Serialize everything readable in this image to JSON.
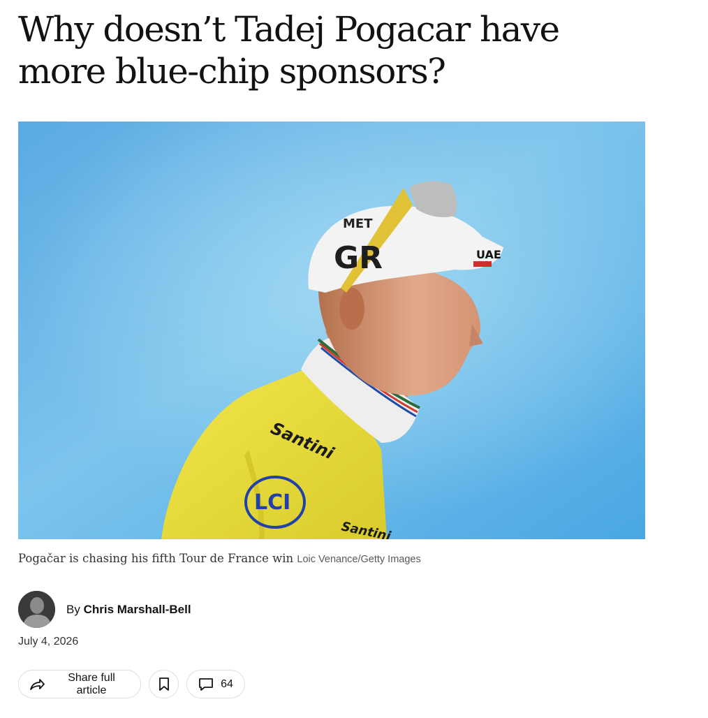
{
  "article": {
    "headline": "Why doesn’t Tadej Pogacar have more blue-chip sponsors?",
    "image": {
      "caption": "Pogačar is chasing his fifth Tour de France win",
      "credit": "Loic Venance/Getty Images",
      "cap_logo_text": "UAE",
      "jersey_text": "Santini",
      "jersey_logo": "LCI"
    },
    "author": {
      "by_prefix": "By",
      "name": "Chris Marshall-Bell"
    },
    "date": "July 4, 2026"
  },
  "actions": {
    "share_label": "Share full article",
    "save_icon": "bookmark-icon",
    "comment_count": "64",
    "comment_icon": "comment-icon",
    "share_icon": "share-arrow-icon"
  },
  "colors": {
    "sky": "#62b5e6",
    "jersey": "#e9df3e",
    "text": "#121212"
  }
}
